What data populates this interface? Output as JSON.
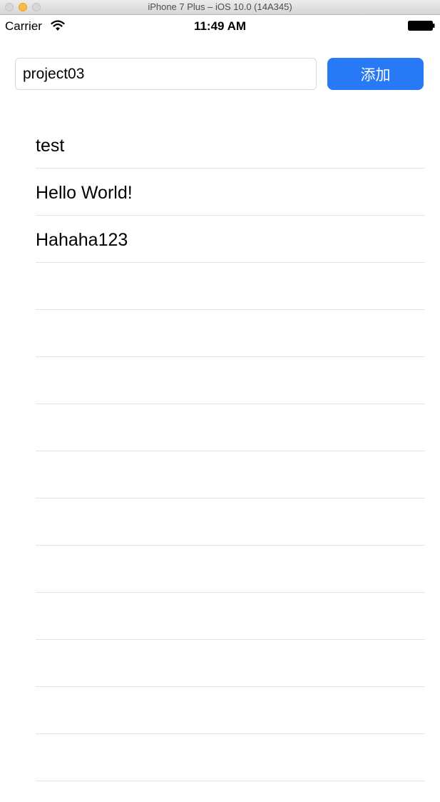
{
  "window": {
    "title": "iPhone 7 Plus – iOS 10.0 (14A345)"
  },
  "status_bar": {
    "carrier": "Carrier",
    "time": "11:49 AM",
    "wifi_icon": "wifi-icon",
    "battery_icon": "battery-icon"
  },
  "input": {
    "value": "project03"
  },
  "add_button": {
    "label": "添加",
    "color": "#2779f6"
  },
  "table": {
    "rows": [
      {
        "label": "test"
      },
      {
        "label": "Hello World!"
      },
      {
        "label": "Hahaha123"
      },
      {
        "label": ""
      },
      {
        "label": ""
      },
      {
        "label": ""
      },
      {
        "label": ""
      },
      {
        "label": ""
      },
      {
        "label": ""
      },
      {
        "label": ""
      },
      {
        "label": ""
      },
      {
        "label": ""
      },
      {
        "label": ""
      },
      {
        "label": ""
      }
    ]
  }
}
